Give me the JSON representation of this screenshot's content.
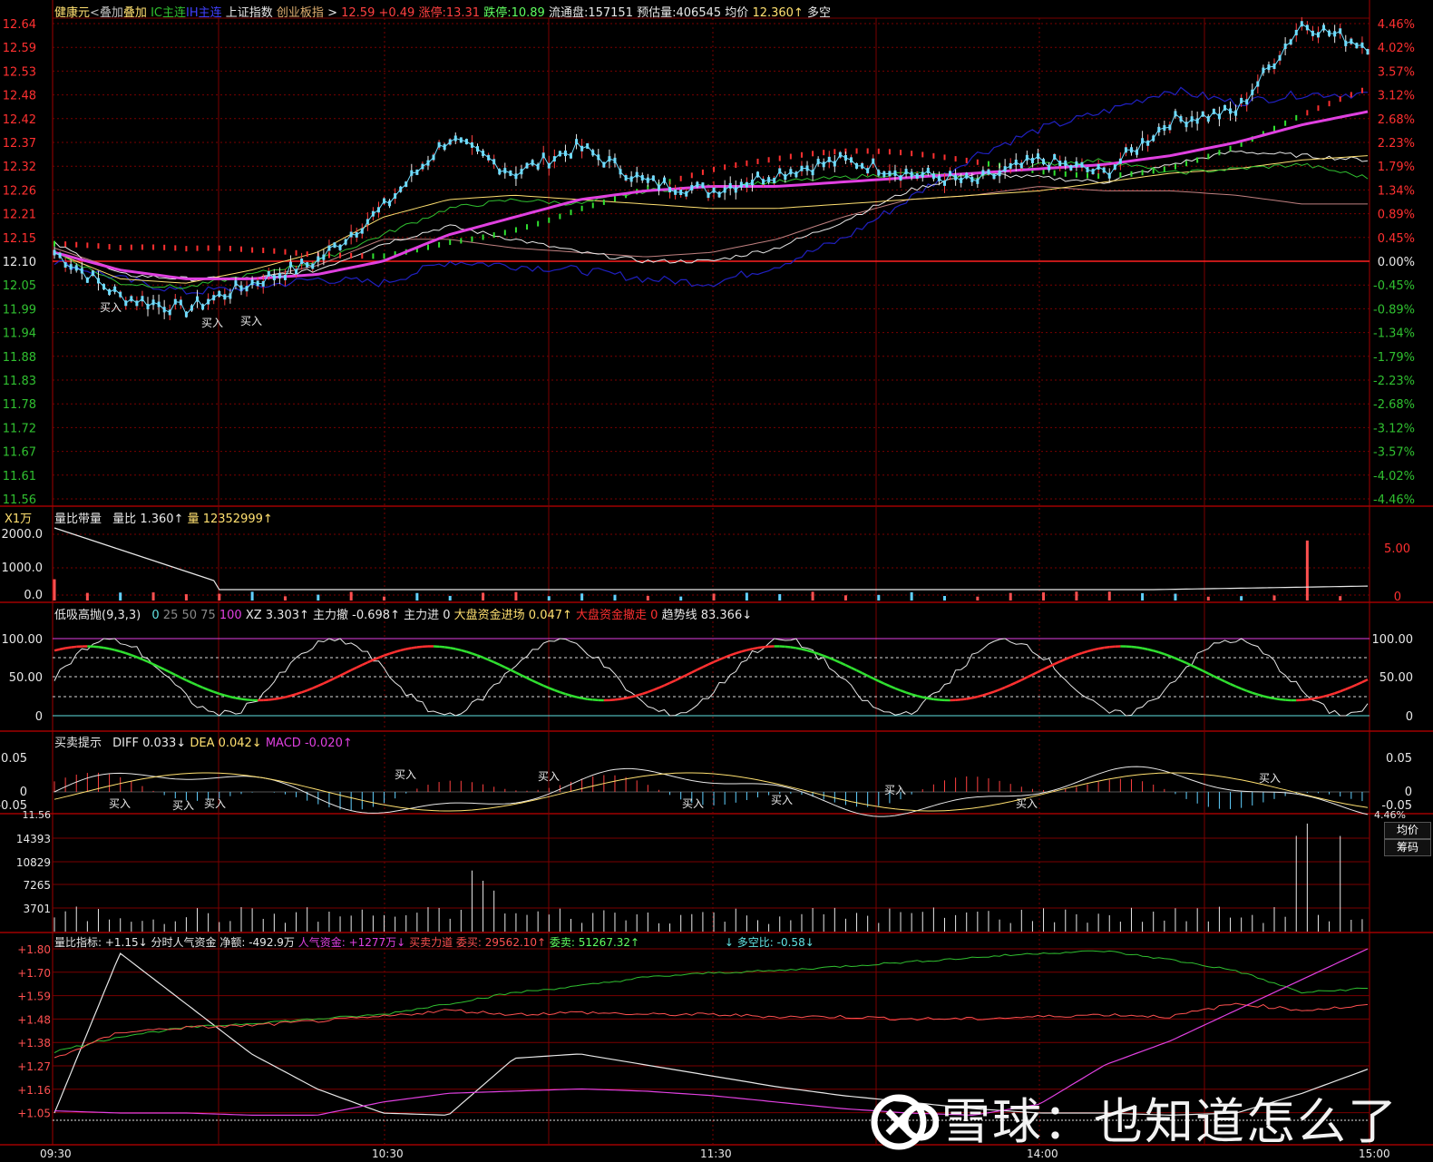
{
  "header": {
    "stock": "健康元",
    "overlay": "<叠加",
    "ic": "IC主连",
    "ih": "IH主连",
    "index1": "上证指数",
    "index2": "创业板指",
    "arrow": ">",
    "price": "12.59",
    "change": "+0.49",
    "limit_up": "涨停:13.31",
    "limit_down": "跌停:10.89",
    "float": "流通盘:157151",
    "estimated_vol": "预估量:406545",
    "avg_label": "均价",
    "avg_value": "12.360↑",
    "longshort": "多空"
  },
  "colors": {
    "grid": "#7a0000",
    "axis_up": "#ff3030",
    "axis_down": "#30c030",
    "price": "#6fdcff",
    "avg": "#e040e0",
    "ic": "#30c030",
    "ih": "#2020c0",
    "yellow": "#ffe070",
    "white": "#e8e8e8",
    "magenta": "#e040e0"
  },
  "price_panel": {
    "y_left": [
      "12.64",
      "12.59",
      "12.53",
      "12.48",
      "12.42",
      "12.37",
      "12.32",
      "12.26",
      "12.21",
      "12.15",
      "12.10",
      "12.05",
      "11.99",
      "11.94",
      "11.88",
      "11.83",
      "11.78",
      "11.72",
      "11.67",
      "11.61",
      "11.56"
    ],
    "y_right": [
      "4.46%",
      "4.02%",
      "3.57%",
      "3.12%",
      "2.68%",
      "2.23%",
      "1.79%",
      "1.34%",
      "0.89%",
      "0.45%",
      "0.00%",
      "-0.45%",
      "-0.89%",
      "-1.34%",
      "-1.79%",
      "-2.23%",
      "-2.68%",
      "-3.12%",
      "-3.57%",
      "-4.02%",
      "-4.46%"
    ],
    "buy_marks": [
      "买入",
      "买入",
      "买入"
    ]
  },
  "volume_panel": {
    "unit": "X1万",
    "title": "量比带量",
    "ratio_label": "量比",
    "ratio_value": "1.360↑",
    "vol_label": "量",
    "vol_value": "12352999↑",
    "y_left": [
      "2000.0",
      "1000.0",
      "0.0"
    ],
    "y_right": [
      "5.00",
      "0"
    ]
  },
  "osc_panel": {
    "title": "低吸高抛(9,3,3)",
    "levels": [
      "0",
      "25",
      "50",
      "75",
      "100"
    ],
    "xz": "XZ 3.303↑",
    "main_out": "主力撤 -0.698↑",
    "main_in": "主力进 0",
    "market_in": "大盘资金进场 0.047↑",
    "market_out": "大盘资金撤走 0",
    "trend": "趋势线 83.366↓",
    "y_left": [
      "100.00",
      "50.00",
      "0"
    ],
    "y_right": [
      "100.00",
      "50.00",
      "0"
    ]
  },
  "macd_panel": {
    "title": "买卖提示",
    "diff": "DIFF 0.033↓",
    "dea": "DEA 0.042↓",
    "macd": "MACD -0.020↑",
    "y_left": [
      "0.05",
      "0",
      "-0.05"
    ],
    "y_right": [
      "0.05",
      "0",
      "-0.05"
    ],
    "buy_marks": [
      "买入",
      "买入",
      "买入",
      "买入",
      "买入",
      "买入",
      "买入",
      "买入",
      "买入",
      "买入"
    ]
  },
  "vol2_panel": {
    "y_left": [
      "14393",
      "10829",
      "7265",
      "3701"
    ],
    "top_left": "11.56",
    "top_right": "4.46%",
    "btn1": "均价",
    "btn2": "筹码"
  },
  "sentiment_panel": {
    "t1": "量比指标: +1.15↓",
    "t2": "分时人气资金",
    "t3": "净额: -492.9万",
    "t4": "人气资金: +1277万↓",
    "t5": "买卖力道",
    "t6": "委买: 29562.10↑",
    "t7": "委卖: 51267.32↑",
    "t8": "↓ 多空比: -0.58↓",
    "y_left": [
      "+1.80",
      "+1.70",
      "+1.59",
      "+1.48",
      "+1.38",
      "+1.27",
      "+1.16",
      "+1.05"
    ]
  },
  "time_axis": [
    "09:30",
    "10:30",
    "11:30",
    "14:00",
    "15:00"
  ],
  "watermark": "雪球：也知道怎么了",
  "chart_data": {
    "type": "line",
    "x": [
      "09:30",
      "10:30",
      "11:30",
      "14:00",
      "15:00"
    ],
    "series": [
      {
        "values": [
          12.12,
          12.02,
          11.99,
          12.05,
          12.1,
          12.22,
          12.38,
          12.3,
          12.36,
          12.28,
          12.26,
          12.3,
          12.33,
          12.3,
          12.28,
          12.33,
          12.3,
          12.42,
          12.44,
          12.64,
          12.59
        ]
      },
      {
        "values": [
          12.12,
          12.08,
          12.06,
          12.06,
          12.07,
          12.1,
          12.16,
          12.2,
          12.24,
          12.26,
          12.27,
          12.27,
          12.28,
          12.29,
          12.3,
          12.31,
          12.32,
          12.34,
          12.37,
          12.41,
          12.44
        ]
      }
    ],
    "ylim": [
      11.56,
      12.64
    ]
  }
}
